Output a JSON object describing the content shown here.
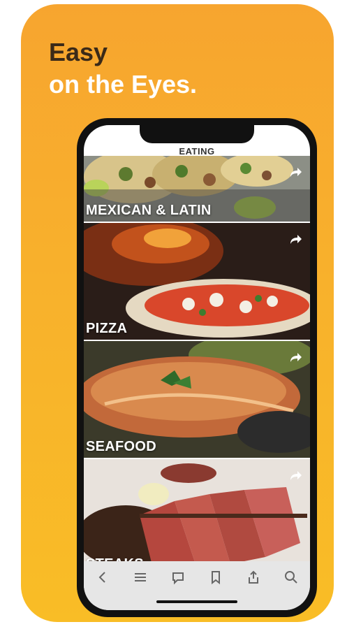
{
  "promo": {
    "line1": "Easy",
    "line2": "on the Eyes."
  },
  "app": {
    "nav_title": "EATING"
  },
  "categories": [
    {
      "label": "MEXICAN & LATIN"
    },
    {
      "label": "PIZZA"
    },
    {
      "label": "SEAFOOD"
    },
    {
      "label": "STEAKS"
    }
  ],
  "toolbar": {
    "items": [
      "back-icon",
      "menu-icon",
      "comment-icon",
      "bookmark-icon",
      "share-icon",
      "search-icon"
    ]
  },
  "colors": {
    "accent_top": "#f7a52f",
    "accent_bottom": "#f9bd26",
    "headline_dark": "#3b2a18"
  }
}
